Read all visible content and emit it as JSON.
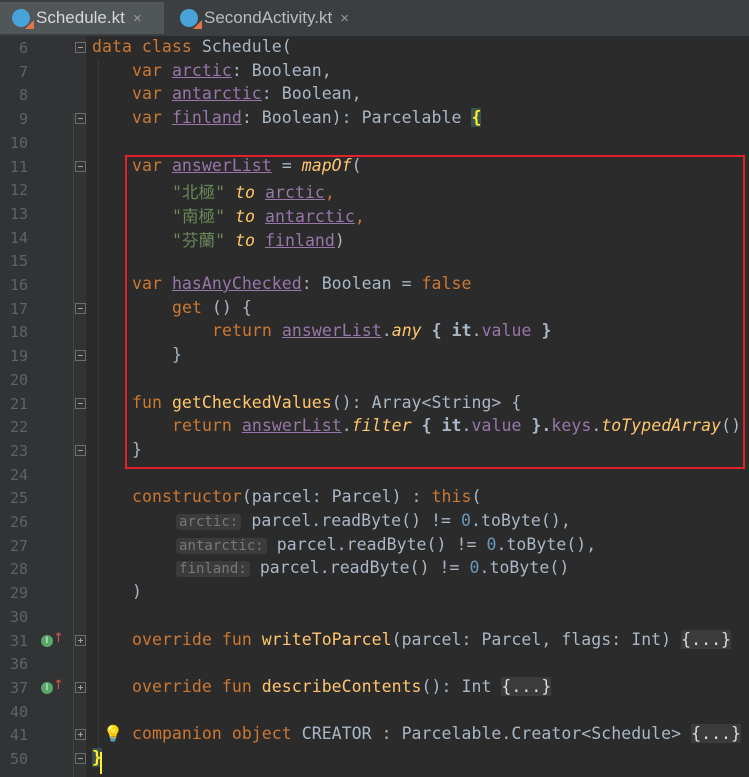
{
  "tabs": [
    {
      "label": "Schedule.kt",
      "close": "×",
      "active": true
    },
    {
      "label": "SecondActivity.kt",
      "close": "×",
      "active": false
    }
  ],
  "lines": {
    "l6": {
      "num": "6",
      "data": "data",
      "class": "class",
      "name": "Schedule("
    },
    "l7": {
      "num": "7",
      "kw": "var",
      "prop": "arctic",
      "rest": ": Boolean,"
    },
    "l8": {
      "num": "8",
      "kw": "var",
      "prop": "antarctic",
      "rest": ": Boolean,"
    },
    "l9": {
      "num": "9",
      "kw": "var",
      "prop": "finland",
      "rest": ": Boolean): Parcelable",
      "brace": "{"
    },
    "l10": {
      "num": "10"
    },
    "l11": {
      "num": "11",
      "kw": "var",
      "prop": "answerList",
      "eq": " = ",
      "fn": "mapOf",
      "rest": "("
    },
    "l12": {
      "num": "12",
      "str": "\"北極\"",
      "to": "to",
      "prop": "arctic",
      "rest": ","
    },
    "l13": {
      "num": "13",
      "str": "\"南極\"",
      "to": "to",
      "prop": "antarctic",
      "rest": ","
    },
    "l14": {
      "num": "14",
      "str": "\"芬蘭\"",
      "to": "to",
      "prop": "finland",
      "rest": ")"
    },
    "l15": {
      "num": "15"
    },
    "l16": {
      "num": "16",
      "kw": "var",
      "prop": "hasAnyChecked",
      "rest": ": Boolean = ",
      "val": "false"
    },
    "l17": {
      "num": "17",
      "kw": "get",
      "rest": " () {"
    },
    "l18": {
      "num": "18",
      "kw": "return",
      "prop": "answerList",
      "dot": ".",
      "fn": "any",
      "b1": " { ",
      "it": "it",
      "dot2": ".",
      "val": "value",
      "b2": " }"
    },
    "l19": {
      "num": "19",
      "rest": "}"
    },
    "l20": {
      "num": "20"
    },
    "l21": {
      "num": "21",
      "kw": "fun",
      "fn": "getCheckedValues",
      "rest": "(): Array<String> {"
    },
    "l22": {
      "num": "22",
      "kw": "return",
      "prop": "answerList",
      "dot": ".",
      "fn": "filter",
      "b1": " { ",
      "it": "it",
      "dot2": ".",
      "val": "value",
      "b2": " }.",
      "keys": "keys",
      "dot3": ".",
      "fn2": "toTypedArray",
      "end": "()"
    },
    "l23": {
      "num": "23",
      "rest": "}"
    },
    "l24": {
      "num": "24"
    },
    "l25": {
      "num": "25",
      "kw": "constructor",
      "rest": "(parcel: Parcel) : ",
      "this": "this",
      "end": "("
    },
    "l26": {
      "num": "26",
      "hint": "arctic:",
      "a": " parcel.readByte() != ",
      "n": "0",
      "b": ".toByte(),"
    },
    "l27": {
      "num": "27",
      "hint": "antarctic:",
      "a": " parcel.readByte() != ",
      "n": "0",
      "b": ".toByte(),"
    },
    "l28": {
      "num": "28",
      "hint": "finland:",
      "a": " parcel.readByte() != ",
      "n": "0",
      "b": ".toByte()"
    },
    "l29": {
      "num": "29",
      "rest": ")"
    },
    "l30": {
      "num": "30"
    },
    "l31": {
      "num": "31",
      "kw1": "override",
      "kw2": "fun",
      "fn": "writeToParcel",
      "rest": "(parcel: Parcel, flags: Int) ",
      "fold": "{...}"
    },
    "l36": {
      "num": "36"
    },
    "l37": {
      "num": "37",
      "kw1": "override",
      "kw2": "fun",
      "fn": "describeContents",
      "rest": "(): Int ",
      "fold": "{...}"
    },
    "l40": {
      "num": "40"
    },
    "l41": {
      "num": "41",
      "kw1": "companion",
      "kw2": "object",
      "rest": "CREATOR : Parcelable.Creator<Schedule> ",
      "fold": "{...}"
    },
    "l50": {
      "num": "50",
      "brace": "}"
    }
  },
  "colors": {
    "highlight_box": "#e0202a",
    "background": "#2b2b2b"
  },
  "icons": {
    "override": "override-indicator-icon",
    "bulb": "lightbulb-icon",
    "kotlin": "kotlin-file-icon"
  }
}
